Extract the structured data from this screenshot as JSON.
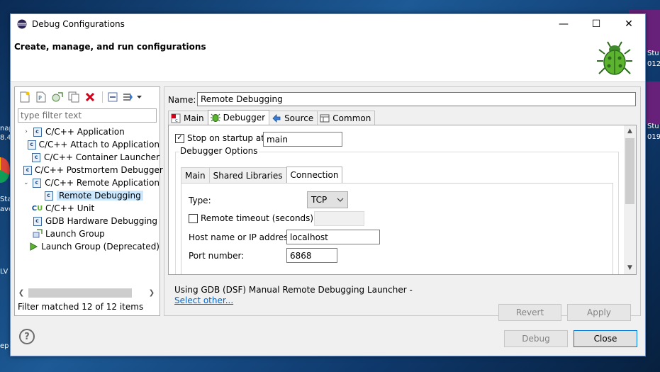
{
  "window": {
    "title": "Debug Configurations",
    "header_title": "Create, manage, and run configurations",
    "minimize_glyph": "—",
    "maximize_glyph": "☐",
    "close_glyph": "✕"
  },
  "desktop": {
    "labels": [
      "nap",
      "8.4",
      "Sta",
      "ave",
      "LV",
      "ep",
      "Stu",
      "012",
      "Stu",
      "019"
    ]
  },
  "left": {
    "filter_placeholder": "type filter text",
    "toolbar_icons": [
      "new-configuration-icon",
      "new-prototype-icon",
      "export-icon",
      "duplicate-icon",
      "delete-icon",
      "collapse-all-icon",
      "filter-menu-icon"
    ],
    "tree": [
      {
        "label": "C/C++ Application",
        "expander": "›",
        "icon": "c-config-icon",
        "level": 0
      },
      {
        "label": "C/C++ Attach to Application",
        "expander": "",
        "icon": "c-config-icon",
        "level": 0
      },
      {
        "label": "C/C++ Container Launcher",
        "expander": "",
        "icon": "c-config-icon",
        "level": 0
      },
      {
        "label": "C/C++ Postmortem Debugger",
        "expander": "",
        "icon": "c-config-icon",
        "level": 0
      },
      {
        "label": "C/C++ Remote Application",
        "expander": "⌄",
        "icon": "c-config-icon",
        "level": 0
      },
      {
        "label": "Remote Debugging",
        "expander": "",
        "icon": "c-config-icon",
        "level": 1,
        "selected": true
      },
      {
        "label": "C/C++ Unit",
        "expander": "",
        "icon": "c-unit-icon",
        "level": 0
      },
      {
        "label": "GDB Hardware Debugging",
        "expander": "",
        "icon": "c-config-icon",
        "level": 0
      },
      {
        "label": "Launch Group",
        "expander": "",
        "icon": "launch-group-icon",
        "level": 0
      },
      {
        "label": "Launch Group (Deprecated)",
        "expander": "",
        "icon": "launch-arrow-icon",
        "level": 0
      }
    ],
    "status": "Filter matched 12 of 12 items"
  },
  "right": {
    "name_label": "Name:",
    "name_value": "Remote Debugging",
    "tabs": [
      {
        "label": "Main",
        "icon": "main-tab-icon"
      },
      {
        "label": "Debugger",
        "icon": "debugger-bug-icon",
        "active": true
      },
      {
        "label": "Source",
        "icon": "source-tab-icon"
      },
      {
        "label": "Common",
        "icon": "common-tab-icon"
      }
    ],
    "stop_on_startup_label": "Stop on startup at:",
    "stop_on_startup_checked": "✓",
    "stop_on_startup_value": "main",
    "debugger_options_label": "Debugger Options",
    "subtabs": [
      "Main",
      "Shared Libraries",
      "Connection"
    ],
    "active_subtab": "Connection",
    "connection": {
      "type_label": "Type:",
      "type_value": "TCP",
      "remote_timeout_label": "Remote timeout (seconds):",
      "host_label": "Host name or IP address:",
      "host_value": "localhost",
      "port_label": "Port number:",
      "port_value": "6868"
    },
    "launcher_text": "Using GDB (DSF) Manual Remote Debugging Launcher -",
    "select_other": "Select other...",
    "revert_label": "Revert",
    "apply_label": "Apply"
  },
  "footer": {
    "help_glyph": "?",
    "debug_label": "Debug",
    "close_label": "Close"
  }
}
